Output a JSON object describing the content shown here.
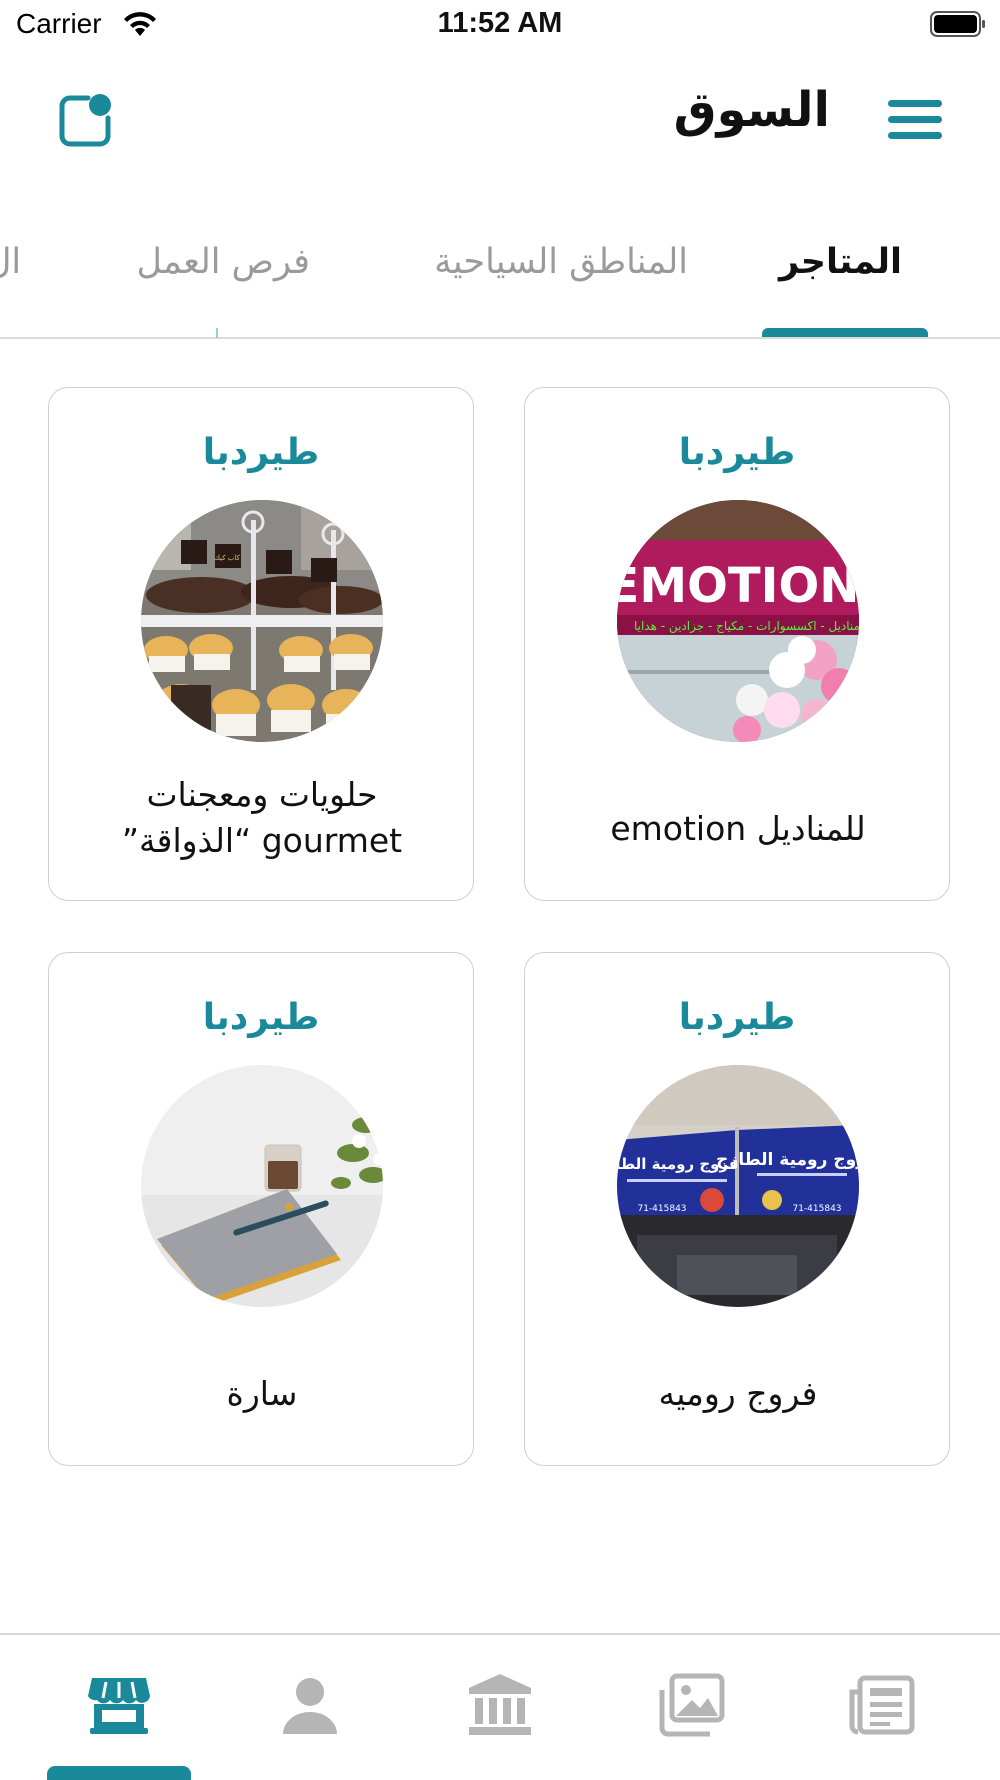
{
  "status_bar": {
    "carrier": "Carrier",
    "time": "11:52 AM"
  },
  "header": {
    "title": "السوق"
  },
  "tabs": [
    {
      "label": "المتاجر",
      "active": true
    },
    {
      "label": "المناطق السياحية",
      "active": false
    },
    {
      "label": "فرص العمل",
      "active": false
    },
    {
      "label": "ال",
      "active": false
    }
  ],
  "stores": [
    {
      "city": "طيردبا",
      "name": "للمناديل emotion"
    },
    {
      "city": "طيردبا",
      "name_line1": "حلويات ومعجنات",
      "name_line2": "gourmet “الذواقة”"
    },
    {
      "city": "طيردبا",
      "name": "فروج روميه"
    },
    {
      "city": "طيردبا",
      "name": "سارة"
    }
  ],
  "thumbnails": {
    "emotion": {
      "sign_text": "EMOTION",
      "sub_text": "مناديل - اكسسوارات - مكياج - جزادين - هدايا"
    },
    "roumieh": {
      "sign_text": "فروج رومية الطازج",
      "phone": "71-415843"
    },
    "gourmet": {
      "tag_text": "كاب كيك"
    }
  },
  "bottom_nav": [
    {
      "icon": "store-icon",
      "active": true
    },
    {
      "icon": "person-icon",
      "active": false
    },
    {
      "icon": "bank-icon",
      "active": false
    },
    {
      "icon": "gallery-icon",
      "active": false
    },
    {
      "icon": "news-icon",
      "active": false
    }
  ],
  "colors": {
    "accent": "#1a8a9a",
    "inactive_icon": "#b5b5b5",
    "inactive_tab": "#9a9a9a"
  }
}
